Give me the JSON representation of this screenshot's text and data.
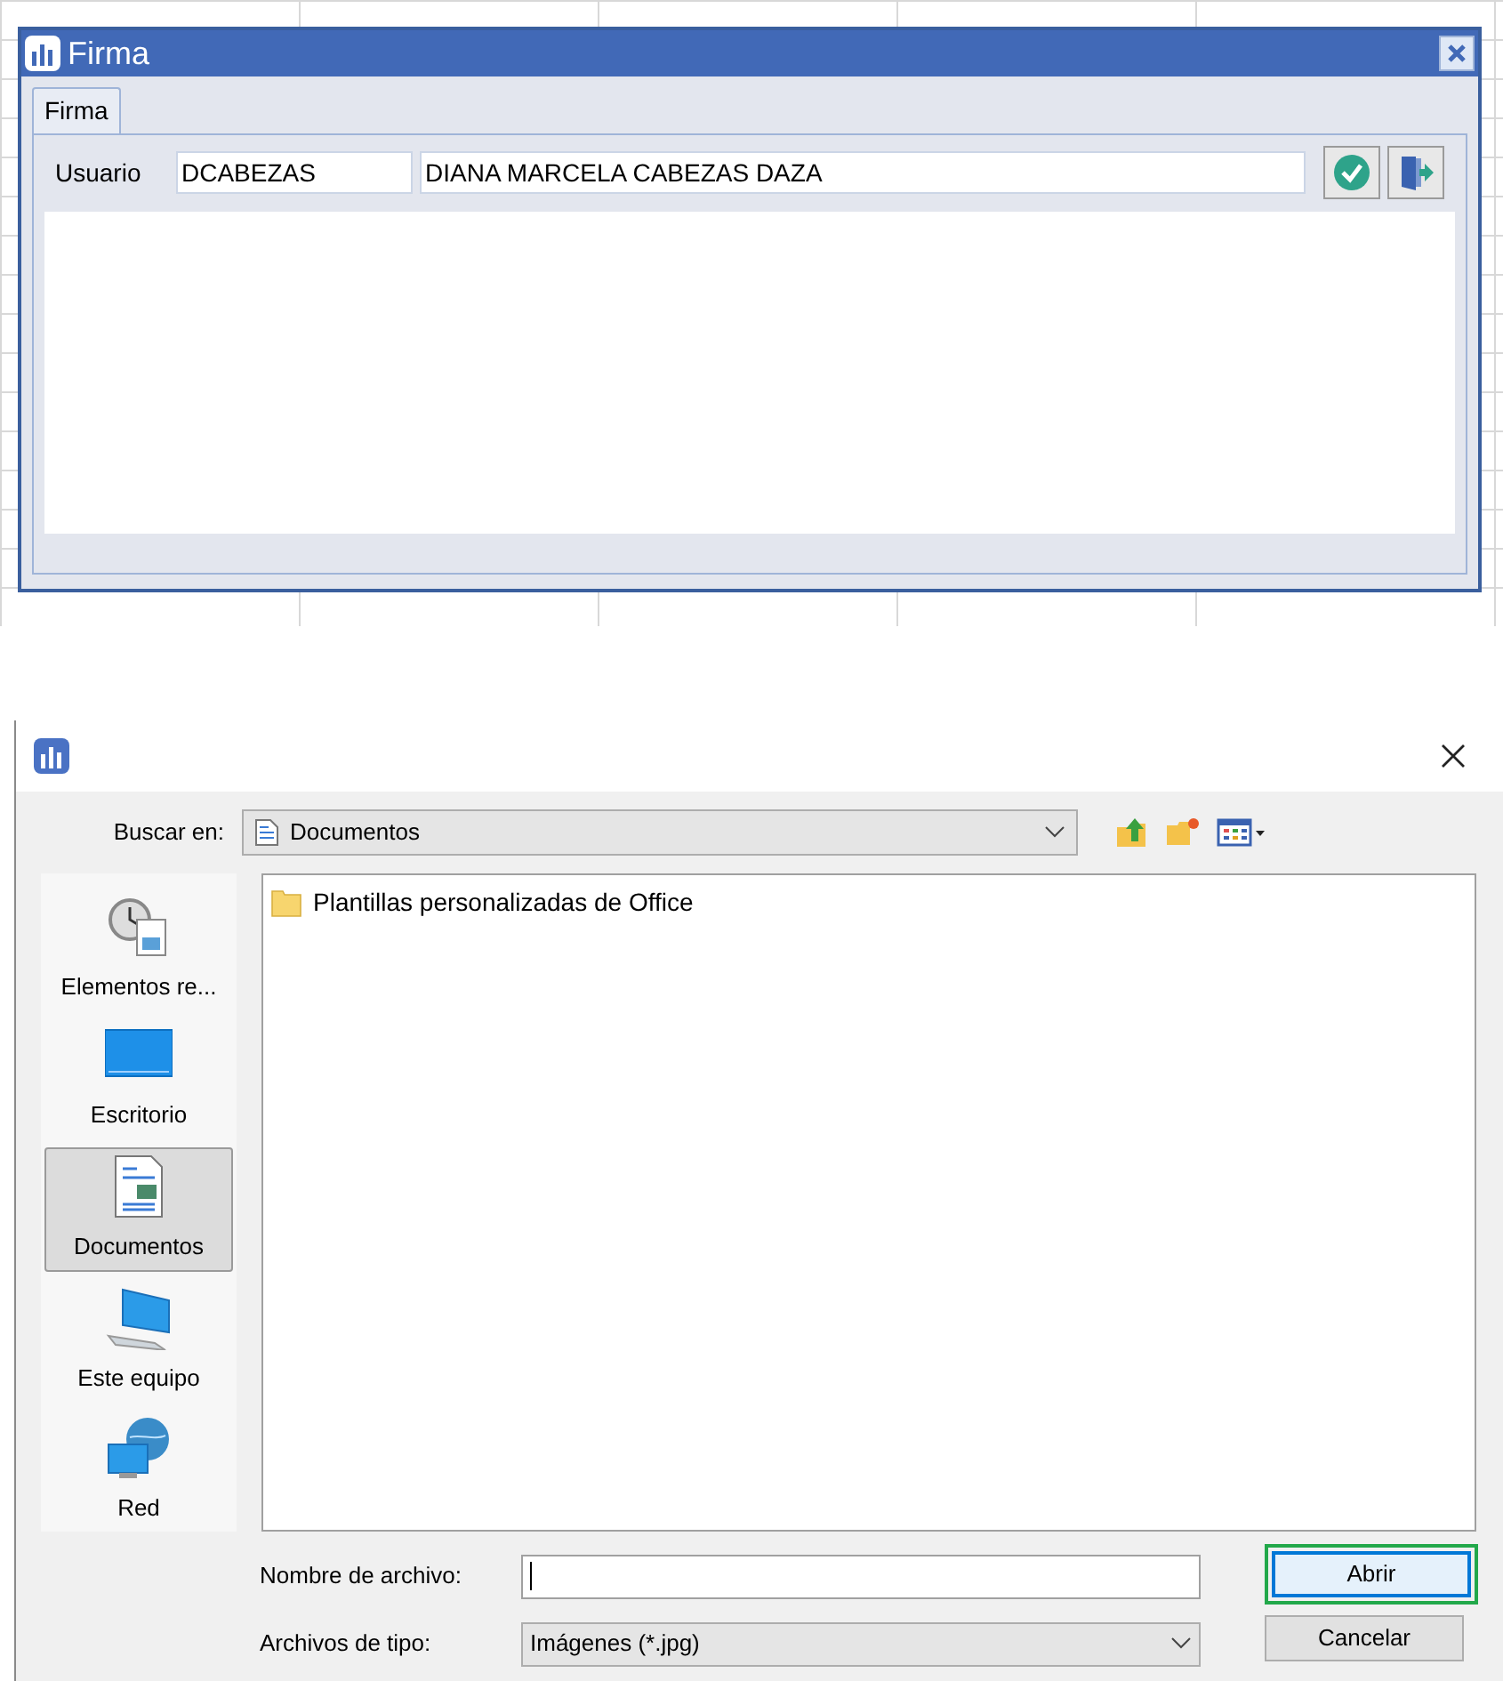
{
  "firma_window": {
    "title": "Firma",
    "tabs": [
      {
        "label": "Firma",
        "selected": true
      }
    ],
    "user_label": "Usuario",
    "user_code": "DCABEZAS",
    "user_name": "DIANA MARCELA CABEZAS DAZA"
  },
  "file_dialog": {
    "look_in_label": "Buscar en:",
    "look_in_value": "Documentos",
    "places": [
      {
        "label": "Elementos re...",
        "kind": "recent",
        "selected": false
      },
      {
        "label": "Escritorio",
        "kind": "desktop",
        "selected": false
      },
      {
        "label": "Documentos",
        "kind": "documents",
        "selected": true
      },
      {
        "label": "Este equipo",
        "kind": "computer",
        "selected": false
      },
      {
        "label": "Red",
        "kind": "network",
        "selected": false
      }
    ],
    "files": [
      {
        "name": "Plantillas personalizadas de Office"
      }
    ],
    "file_name_label": "Nombre de archivo:",
    "file_type_label": "Archivos de tipo:",
    "file_type_value": "Imágenes (*.jpg)",
    "buttons": [
      {
        "label": "Abrir",
        "highlighted": true
      },
      {
        "label": "Cancelar",
        "highlighted": false
      }
    ]
  }
}
